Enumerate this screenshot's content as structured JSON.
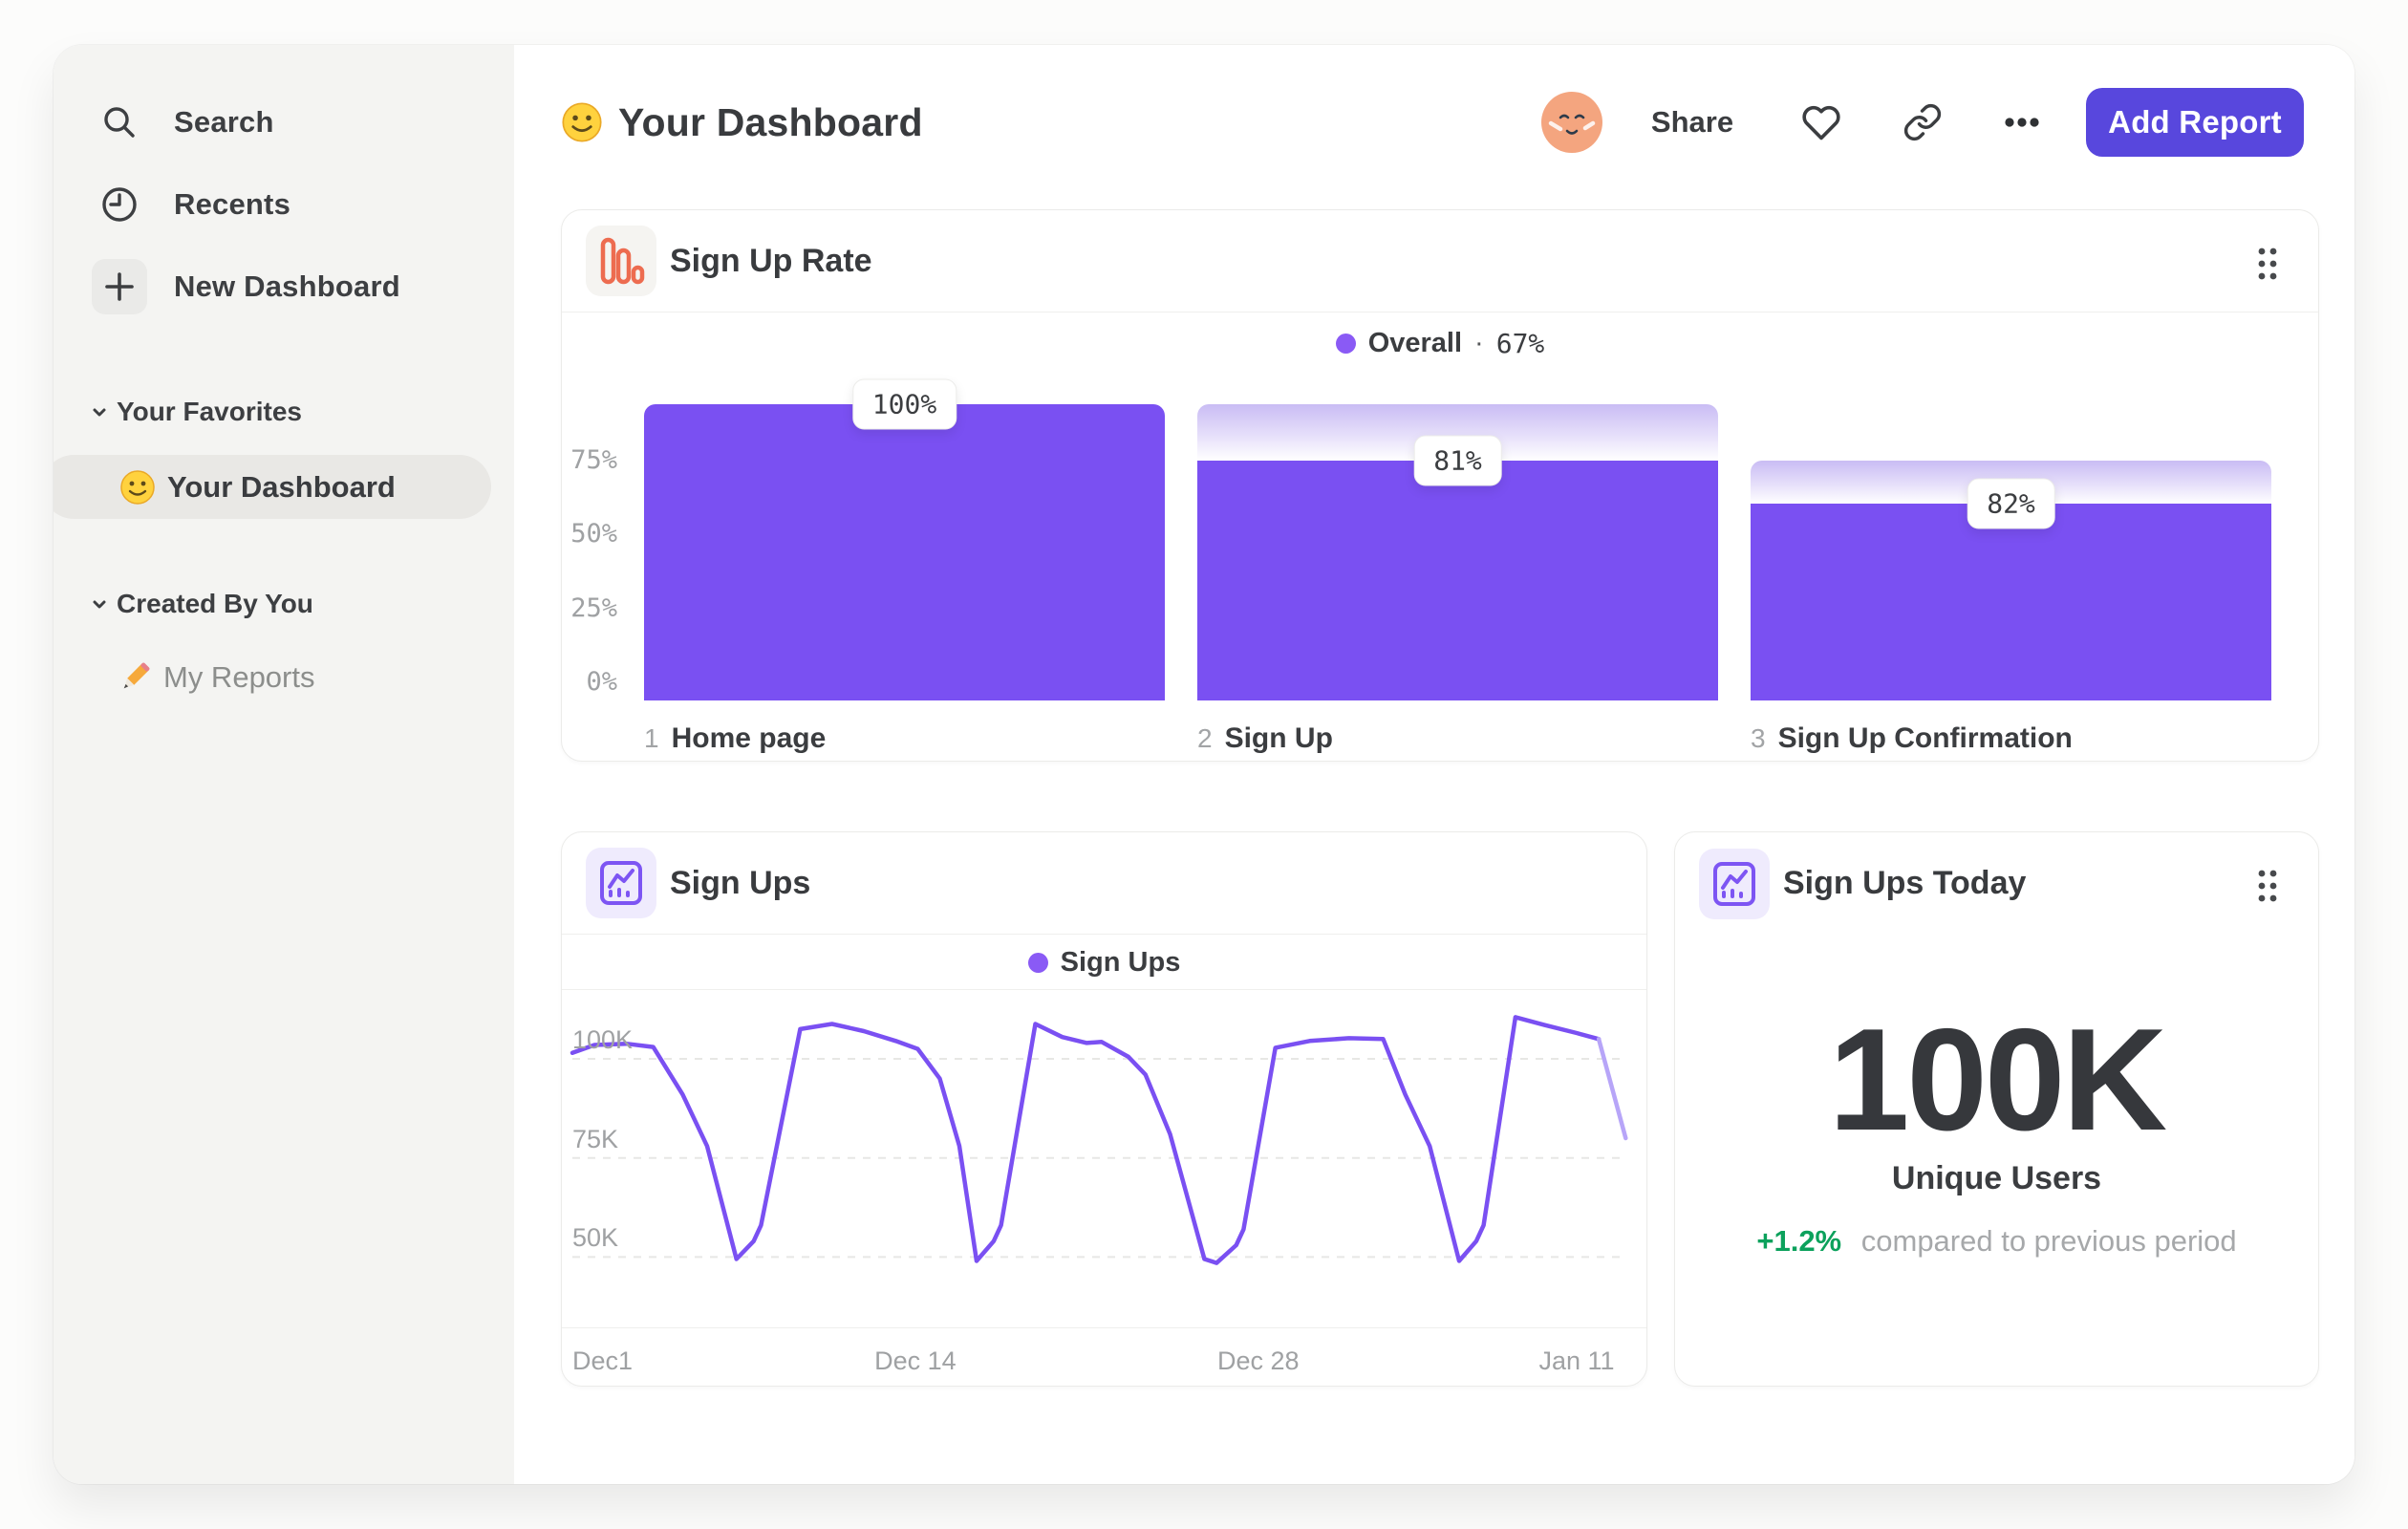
{
  "sidebar": {
    "search_label": "Search",
    "recents_label": "Recents",
    "new_dashboard_label": "New Dashboard",
    "favorites_section": "Your Favorites",
    "favorite_item": "Your Dashboard",
    "created_section": "Created By You",
    "created_item": "My Reports"
  },
  "header": {
    "title": "Your Dashboard",
    "share_label": "Share",
    "add_report_label": "Add Report"
  },
  "cards": {
    "signup_rate": {
      "title": "Sign Up Rate"
    },
    "sign_ups": {
      "title": "Sign Ups"
    },
    "sign_ups_today": {
      "title": "Sign Ups Today",
      "value": "100K",
      "label": "Unique Users",
      "delta": "+1.2%",
      "delta_note": "compared to previous period"
    }
  },
  "colors": {
    "accent_purple": "#7a50f2",
    "legend_dot": "#8a5af5",
    "button_indigo": "#5847dd",
    "icon_orange": "#ed6c50",
    "delta_green": "#0ca15c",
    "sidebar_bg": "#f4f4f2"
  },
  "chart_data": [
    {
      "type": "bar",
      "variant": "funnel",
      "title": "Sign Up Rate",
      "legend": {
        "name": "Overall",
        "sep": "·",
        "value": "67%"
      },
      "ylim": [
        0,
        100
      ],
      "y_ticks": [
        {
          "label": "75%",
          "value": 75
        },
        {
          "label": "50%",
          "value": 50
        },
        {
          "label": "25%",
          "value": 25
        },
        {
          "label": "0%",
          "value": 0
        }
      ],
      "steps": [
        {
          "index": "1",
          "label": "Home page",
          "rate_label": "100%",
          "step_rate": 100,
          "cumulative": 100
        },
        {
          "index": "2",
          "label": "Sign Up",
          "rate_label": "81%",
          "step_rate": 81,
          "cumulative": 81
        },
        {
          "index": "3",
          "label": "Sign Up Confirmation",
          "rate_label": "82%",
          "step_rate": 82,
          "cumulative": 66.4
        }
      ]
    },
    {
      "type": "line",
      "title": "Sign Ups",
      "legend": "Sign Ups",
      "unit": "K users",
      "grid": "dashed-horizontal",
      "ylim_k": [
        40,
        115
      ],
      "y_ticks": [
        {
          "label": "100K",
          "value": 100
        },
        {
          "label": "75K",
          "value": 75
        },
        {
          "label": "50K",
          "value": 50
        }
      ],
      "x_ticks": [
        {
          "label": "Dec1",
          "day": 0,
          "align": "left"
        },
        {
          "label": "Dec 14",
          "day": 14,
          "align": "center"
        },
        {
          "label": "Dec 28",
          "day": 28,
          "align": "center"
        },
        {
          "label": "Jan 11",
          "day": 41,
          "align": "center"
        }
      ],
      "series": [
        {
          "name": "Sign Ups",
          "incomplete_tail_points": 2,
          "points": [
            [
              0,
              101.5
            ],
            [
              0.9,
              103.5
            ],
            [
              2.2,
              103.8
            ],
            [
              3.3,
              103
            ],
            [
              4.5,
              91
            ],
            [
              5.5,
              78
            ],
            [
              6.7,
              49.5
            ],
            [
              7.4,
              54
            ],
            [
              7.7,
              58
            ],
            [
              9.3,
              107.5
            ],
            [
              10.6,
              108.8
            ],
            [
              11.9,
              107
            ],
            [
              13.2,
              104.5
            ],
            [
              14.1,
              102.5
            ],
            [
              15,
              95
            ],
            [
              15.8,
              78
            ],
            [
              16.5,
              49
            ],
            [
              17.2,
              54
            ],
            [
              17.5,
              58
            ],
            [
              18.9,
              108.8
            ],
            [
              20,
              105.5
            ],
            [
              21,
              104
            ],
            [
              21.6,
              104.3
            ],
            [
              22.7,
              100.5
            ],
            [
              23.4,
              96
            ],
            [
              24.4,
              81
            ],
            [
              25.8,
              49.5
            ],
            [
              26.3,
              48.5
            ],
            [
              27.1,
              53
            ],
            [
              27.4,
              57
            ],
            [
              28.7,
              102.8
            ],
            [
              30.1,
              104.5
            ],
            [
              31.7,
              105.2
            ],
            [
              33.1,
              105
            ],
            [
              34,
              91
            ],
            [
              35,
              78
            ],
            [
              36.2,
              49
            ],
            [
              36.9,
              54
            ],
            [
              37.2,
              58
            ],
            [
              38.5,
              110.5
            ],
            [
              39.7,
              108.5
            ],
            [
              41,
              106.5
            ],
            [
              41.9,
              105
            ],
            [
              43,
              80
            ]
          ]
        }
      ]
    }
  ]
}
